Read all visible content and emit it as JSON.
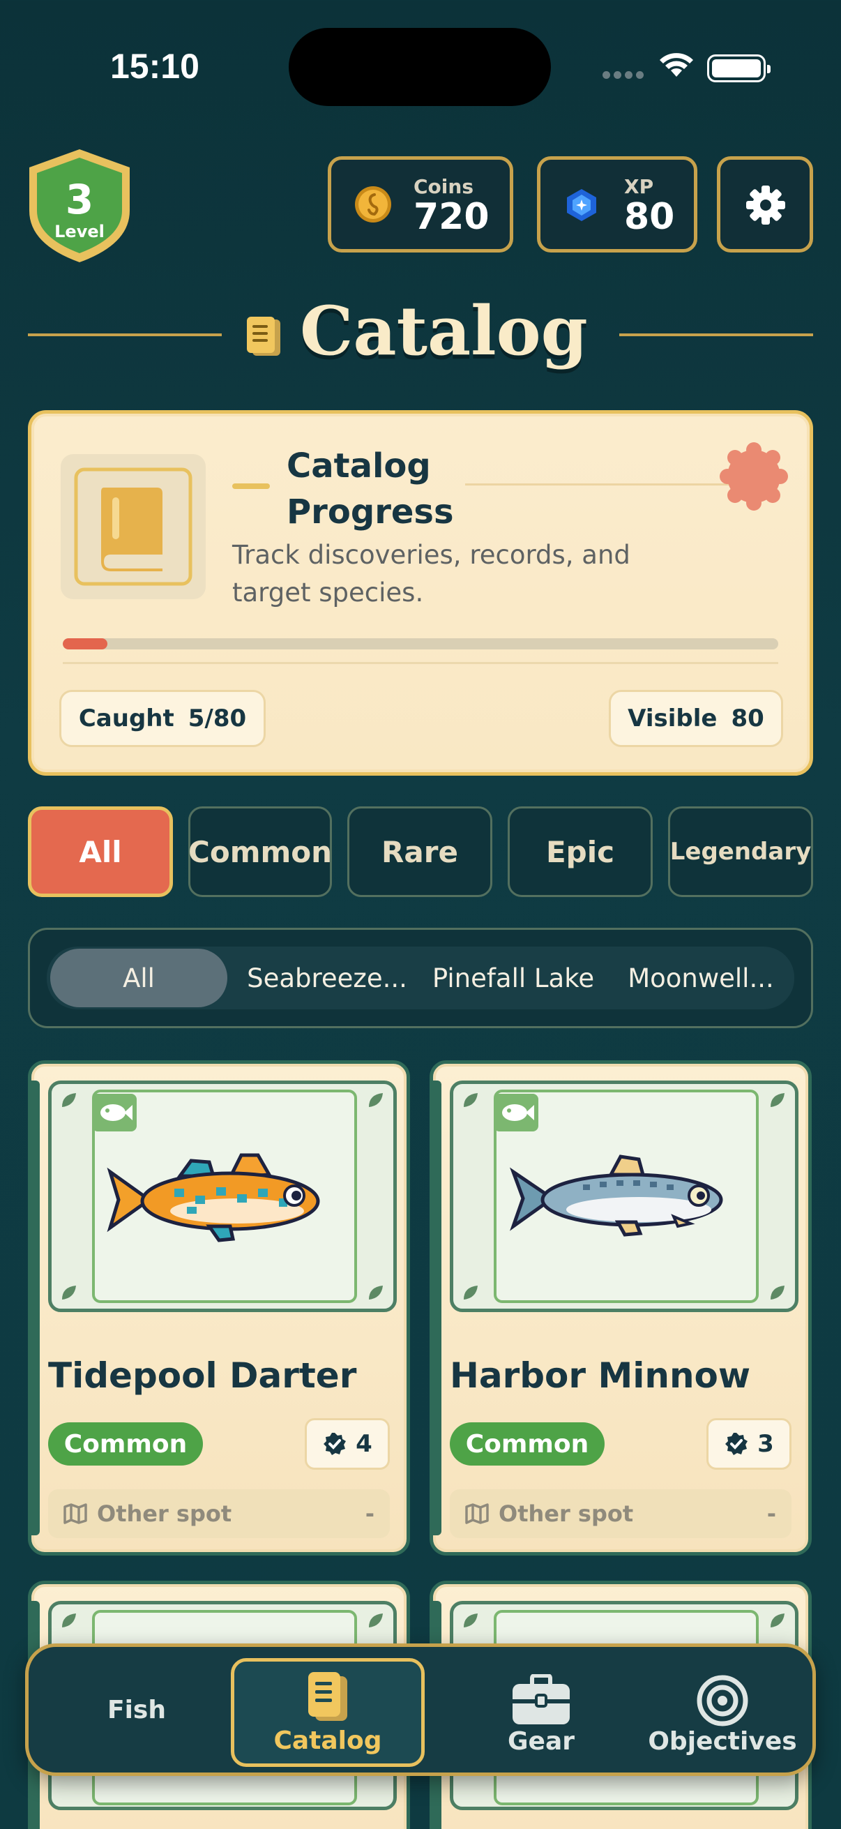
{
  "status_bar": {
    "time": "15:10"
  },
  "header": {
    "level": {
      "value": "3",
      "label": "Level"
    },
    "coins": {
      "label": "Coins",
      "value": "720"
    },
    "xp": {
      "label": "XP",
      "value": "80"
    }
  },
  "page": {
    "title": "Catalog"
  },
  "progress_card": {
    "title": "Catalog Progress",
    "subtitle": "Track discoveries, records, and target species.",
    "progress": 0.0625,
    "caught_label": "Caught",
    "caught_value": "5/80",
    "visible_label": "Visible",
    "visible_value": "80"
  },
  "rarity_tabs": [
    "All",
    "Common",
    "Rare",
    "Epic",
    "Legendary"
  ],
  "rarity_selected": "All",
  "location_tabs": [
    "All",
    "Seabreeze...",
    "Pinefall Lake",
    "Moonwell..."
  ],
  "location_selected": "All",
  "fish": [
    {
      "name": "Tidepool Darter",
      "rarity": "Common",
      "count": "4",
      "spot": "Other spot",
      "spot_value": "-"
    },
    {
      "name": "Harbor Minnow",
      "rarity": "Common",
      "count": "3",
      "spot": "Other spot",
      "spot_value": "-"
    }
  ],
  "nav": [
    {
      "label": "Fish",
      "icon": "fish-icon"
    },
    {
      "label": "Catalog",
      "icon": "catalog-icon",
      "active": true
    },
    {
      "label": "Gear",
      "icon": "toolbox-icon"
    },
    {
      "label": "Objectives",
      "icon": "target-icon"
    }
  ],
  "colors": {
    "background": "#0f3b43",
    "accent_gold": "#c7a24c",
    "coral": "#e4694f",
    "common_green": "#4ea347",
    "card_cream": "#fbeccd"
  }
}
